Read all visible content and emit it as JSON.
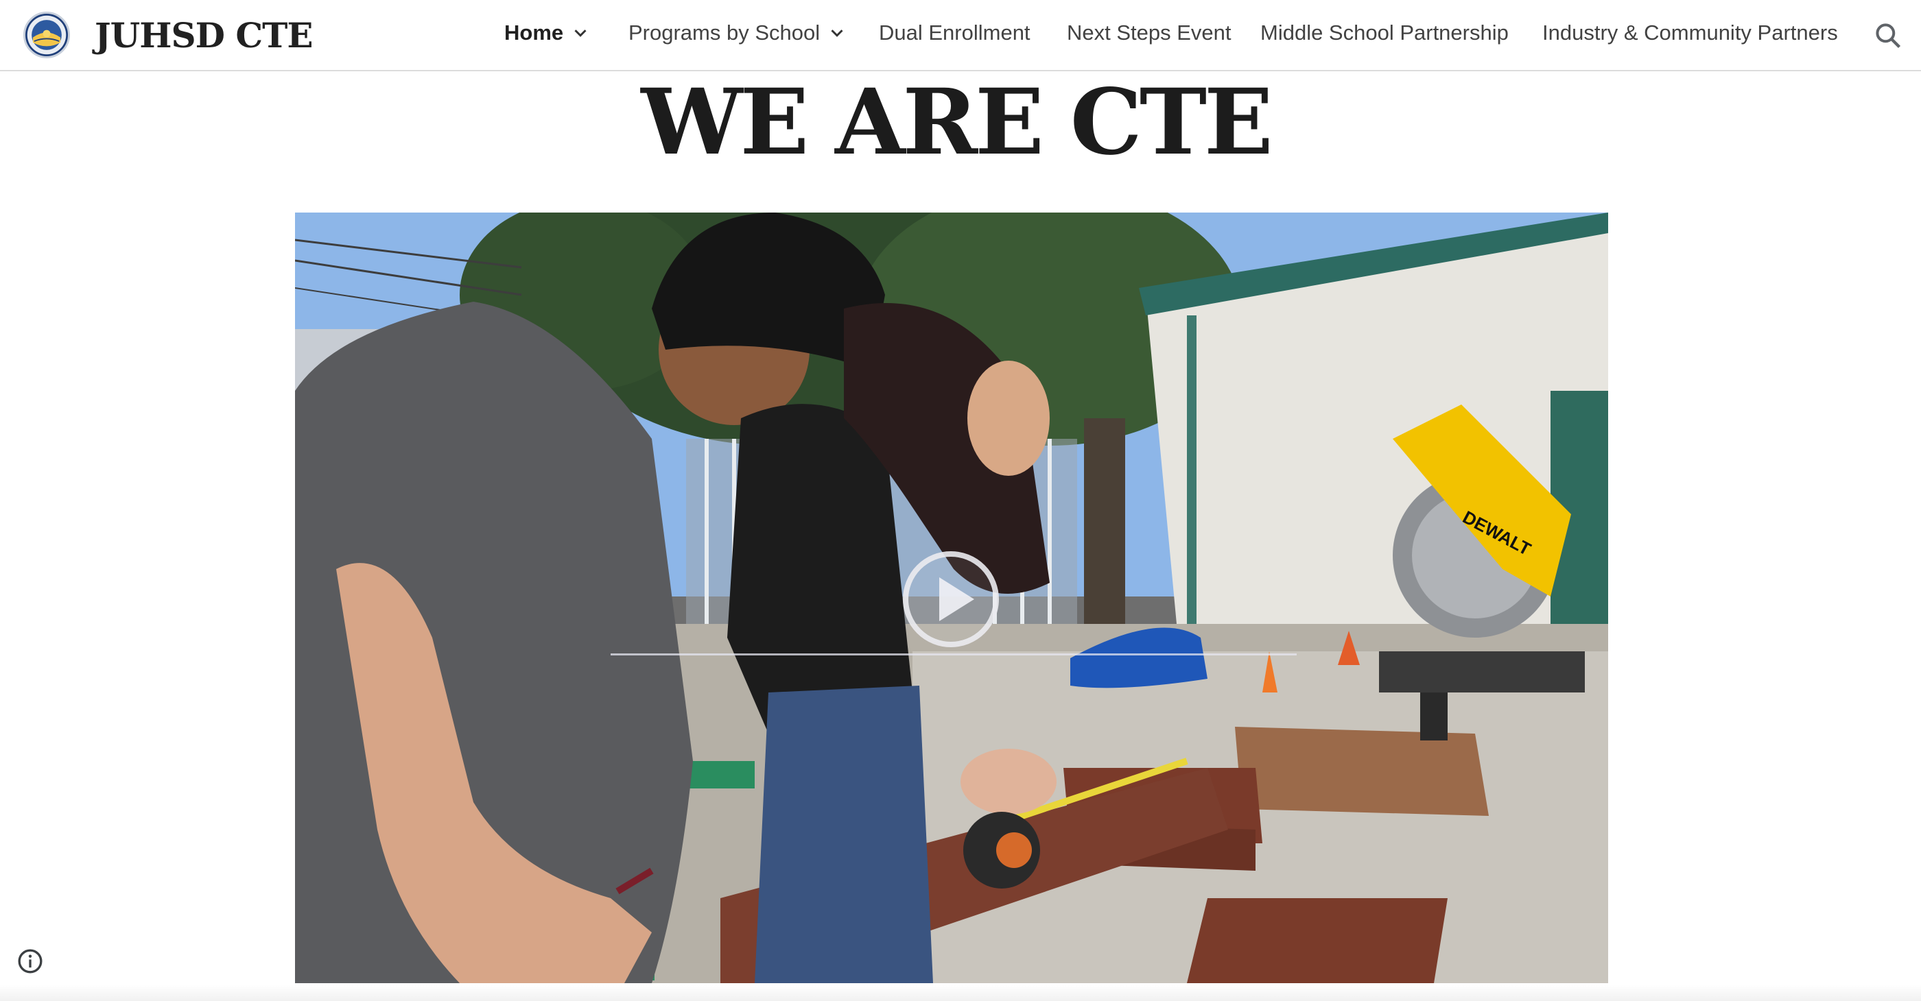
{
  "site": {
    "title": "JUHSD CTE"
  },
  "nav": {
    "items": [
      {
        "label": "Home",
        "has_dropdown": true,
        "active": true
      },
      {
        "label": "Programs by School",
        "has_dropdown": true,
        "active": false
      },
      {
        "label": "Dual Enrollment",
        "has_dropdown": false,
        "active": false
      },
      {
        "label": "Next Steps Event",
        "has_dropdown": false,
        "active": false
      },
      {
        "label": "Middle School Partnership",
        "has_dropdown": false,
        "active": false
      },
      {
        "label": "Industry & Community Partners",
        "has_dropdown": false,
        "active": false
      }
    ],
    "search_icon": "search-icon"
  },
  "hero": {
    "title": "WE ARE CTE"
  },
  "video": {
    "play_icon": "play-icon",
    "saw_brand": "DEWALT"
  },
  "footer": {
    "info_icon": "info-icon"
  },
  "colors": {
    "title_text": "#1c1c1c",
    "nav_text": "#424242",
    "header_border": "#dcdcdc",
    "saw_yellow": "#f2c200"
  }
}
